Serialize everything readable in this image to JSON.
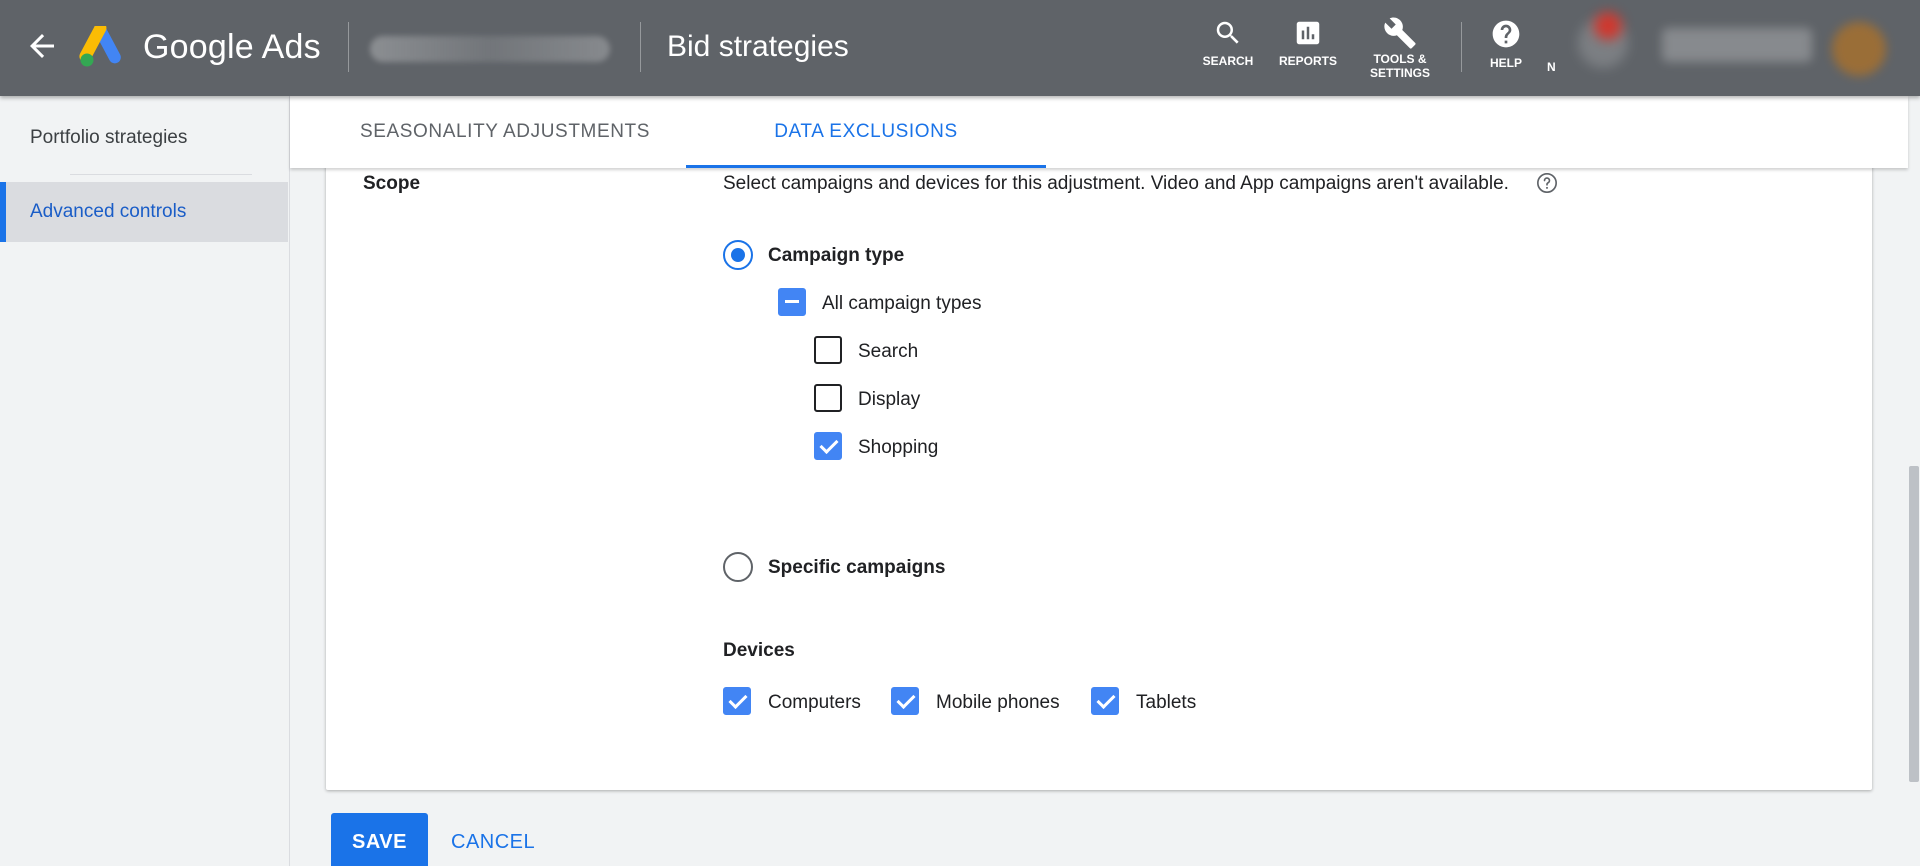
{
  "header": {
    "brand": "Google Ads",
    "page_title": "Bid strategies",
    "tools": [
      {
        "label": "SEARCH",
        "icon": "search-icon"
      },
      {
        "label": "REPORTS",
        "icon": "reports-icon"
      },
      {
        "label": "TOOLS & SETTINGS",
        "icon": "wrench-icon"
      },
      {
        "label": "HELP",
        "icon": "help-icon"
      }
    ],
    "notifications_label": "N"
  },
  "sidebar": {
    "items": [
      {
        "label": "Portfolio strategies",
        "active": false
      },
      {
        "label": "Advanced controls",
        "active": true
      }
    ]
  },
  "tabs": [
    {
      "label": "SEASONALITY ADJUSTMENTS",
      "active": false
    },
    {
      "label": "DATA EXCLUSIONS",
      "active": true
    }
  ],
  "scope": {
    "label": "Scope",
    "description": "Select campaigns and devices for this adjustment. Video and App campaigns aren't available.",
    "options": {
      "campaign_type": {
        "label": "Campaign type",
        "selected": true
      },
      "specific_campaigns": {
        "label": "Specific campaigns",
        "selected": false
      }
    },
    "campaign_types": {
      "all": {
        "label": "All campaign types",
        "state": "indeterminate"
      },
      "items": [
        {
          "label": "Search",
          "checked": false
        },
        {
          "label": "Display",
          "checked": false
        },
        {
          "label": "Shopping",
          "checked": true
        }
      ]
    },
    "devices": {
      "title": "Devices",
      "items": [
        {
          "label": "Computers",
          "checked": true
        },
        {
          "label": "Mobile phones",
          "checked": true
        },
        {
          "label": "Tablets",
          "checked": true
        }
      ]
    }
  },
  "actions": {
    "save_label": "SAVE",
    "cancel_label": "CANCEL"
  },
  "colors": {
    "header_bg": "#5f6368",
    "accent": "#1a73e8",
    "checkbox_blue": "#4285f4"
  }
}
